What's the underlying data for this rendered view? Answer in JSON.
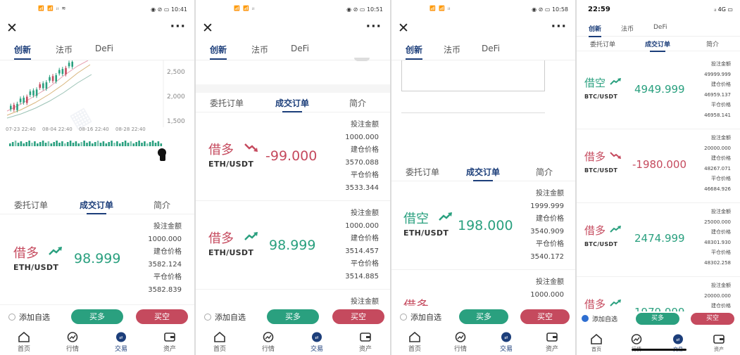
{
  "phones": [
    {
      "status": {
        "signal": "📶 📶 ᵢₗ ≋",
        "time": "10:41",
        "icons": "◉ ⊘ ▭"
      },
      "tabs": [
        "创新",
        "法币",
        "DeFi"
      ],
      "chart": {
        "y_ticks": [
          "2,500",
          "2,000",
          "1,500"
        ],
        "x_ticks": [
          "07-23 22:40",
          "08-04 22:40",
          "08-16 22:40",
          "08-28 22:40"
        ]
      },
      "subtabs": [
        "委托订单",
        "成交订单",
        "简介"
      ],
      "orders": [
        {
          "dir": "借多",
          "pair": "ETH/USDT",
          "amount": "98.999",
          "labels": [
            "投注金额",
            "建仓价格",
            "平仓价格"
          ],
          "values": [
            "1000.000",
            "3582.124",
            "3582.839"
          ]
        }
      ],
      "favorite": "添加自选",
      "btn_long": "买多",
      "btn_short": "买空",
      "nav": [
        "首页",
        "行情",
        "交易",
        "资产"
      ]
    },
    {
      "status": {
        "signal": "📶 📶 ᵢₗ",
        "time": "10:51",
        "icons": "◉ ⊘ ▭"
      },
      "tabs": [
        "创新",
        "法币",
        "DeFi"
      ],
      "subtabs": [
        "委托订单",
        "成交订单",
        "简介"
      ],
      "orders": [
        {
          "dir": "借多",
          "pair": "ETH/USDT",
          "amount": "-99.000",
          "labels": [
            "投注金额",
            "建仓价格",
            "平仓价格"
          ],
          "values": [
            "1000.000",
            "3570.088",
            "3533.344"
          ]
        },
        {
          "dir": "借多",
          "pair": "ETH/USDT",
          "amount": "98.999",
          "labels": [
            "投注金额",
            "建仓价格",
            "平仓价格"
          ],
          "values": [
            "1000.000",
            "3514.457",
            "3514.885"
          ]
        },
        {
          "labels": [
            "投注金额"
          ]
        }
      ],
      "favorite": "添加自选",
      "btn_long": "买多",
      "btn_short": "买空",
      "nav": [
        "首页",
        "行情",
        "交易",
        "资产"
      ]
    },
    {
      "status": {
        "signal": "📶 📶 ᵢₗ",
        "time": "10:58",
        "icons": "◉ ⊘ ▭"
      },
      "tabs": [
        "创新",
        "法币",
        "DeFi"
      ],
      "subtabs": [
        "委托订单",
        "成交订单",
        "简介"
      ],
      "orders": [
        {
          "dir": "借空",
          "pair": "ETH/USDT",
          "amount": "198.000",
          "labels": [
            "投注金额",
            "建仓价格",
            "平仓价格"
          ],
          "values": [
            "1999.999",
            "3540.909",
            "3540.172"
          ]
        },
        {
          "dir": "借多",
          "labels": [
            "投注金额"
          ],
          "values": [
            "1000.000"
          ]
        }
      ],
      "favorite": "添加自选",
      "btn_long": "买多",
      "btn_short": "买空",
      "nav": [
        "首页",
        "行情",
        "交易",
        "资产"
      ]
    },
    {
      "status": {
        "time": "22:59",
        "icons": "ᵢₗ 4G ▭"
      },
      "tabs": [
        "创新",
        "法币",
        "DeFi"
      ],
      "subtabs": [
        "委托订单",
        "成交订单",
        "简介"
      ],
      "orders": [
        {
          "dir": "借空",
          "pair": "BTC/USDT",
          "amount": "4949.999",
          "labels": [
            "投注金额",
            "建仓价格",
            "平仓价格"
          ],
          "values": [
            "49999.999",
            "46959.137",
            "46958.141"
          ]
        },
        {
          "dir": "借多",
          "pair": "BTC/USDT",
          "amount": "-1980.000",
          "labels": [
            "投注金额",
            "建仓价格",
            "平仓价格"
          ],
          "values": [
            "20000.000",
            "48267.071",
            "46684.926"
          ]
        },
        {
          "dir": "借多",
          "pair": "BTC/USDT",
          "amount": "2474.999",
          "labels": [
            "投注金额",
            "建仓价格",
            "平仓价格"
          ],
          "values": [
            "25000.000",
            "48301.930",
            "48302.258"
          ]
        },
        {
          "dir": "借多",
          "amount": "1979.999",
          "labels": [
            "投注金额",
            "建仓价格"
          ],
          "values": [
            "20000.000"
          ]
        }
      ],
      "favorite": "添加自选",
      "btn_long": "买多",
      "btn_short": "买空",
      "nav": [
        "首页",
        "行情",
        "交易",
        "资产"
      ]
    }
  ],
  "colors": {
    "long": "#2aa07f",
    "short": "#c54a5e",
    "accent": "#1c3e7a"
  },
  "icons": [
    "close-icon",
    "more-icon",
    "trend-up-icon",
    "trend-down-icon",
    "home-icon",
    "market-icon",
    "trade-icon",
    "wallet-icon"
  ]
}
